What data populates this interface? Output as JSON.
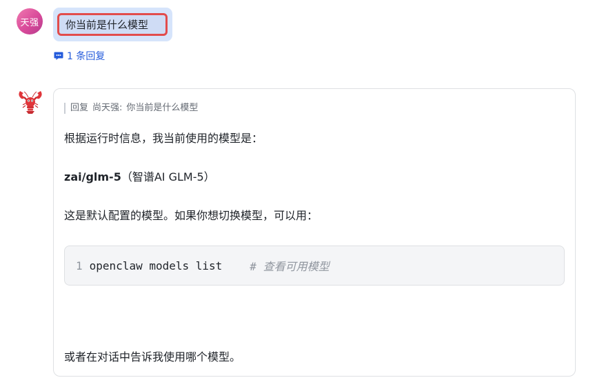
{
  "user_message": {
    "avatar_text": "天强",
    "text": "你当前是什么模型",
    "reply_count_label": "1 条回复"
  },
  "bot_message": {
    "avatar_icon": "lobster-icon",
    "quote": {
      "prefix": "回复",
      "author": "尚天强:",
      "text": "你当前是什么模型"
    },
    "paragraph1": "根据运行时信息，我当前使用的模型是：",
    "model_name": "zai/glm-5",
    "model_desc": "（智谱AI GLM-5）",
    "paragraph3": "这是默认配置的模型。如果你想切换模型，可以用：",
    "code": {
      "line_number": "1",
      "command": "openclaw models list",
      "comment": "# 查看可用模型"
    },
    "paragraph4": "或者在对话中告诉我使用哪个模型。"
  },
  "colors": {
    "accent_link": "#245bdb",
    "highlight_border": "#e24c4c",
    "user_bubble": "#d6e4fb"
  }
}
